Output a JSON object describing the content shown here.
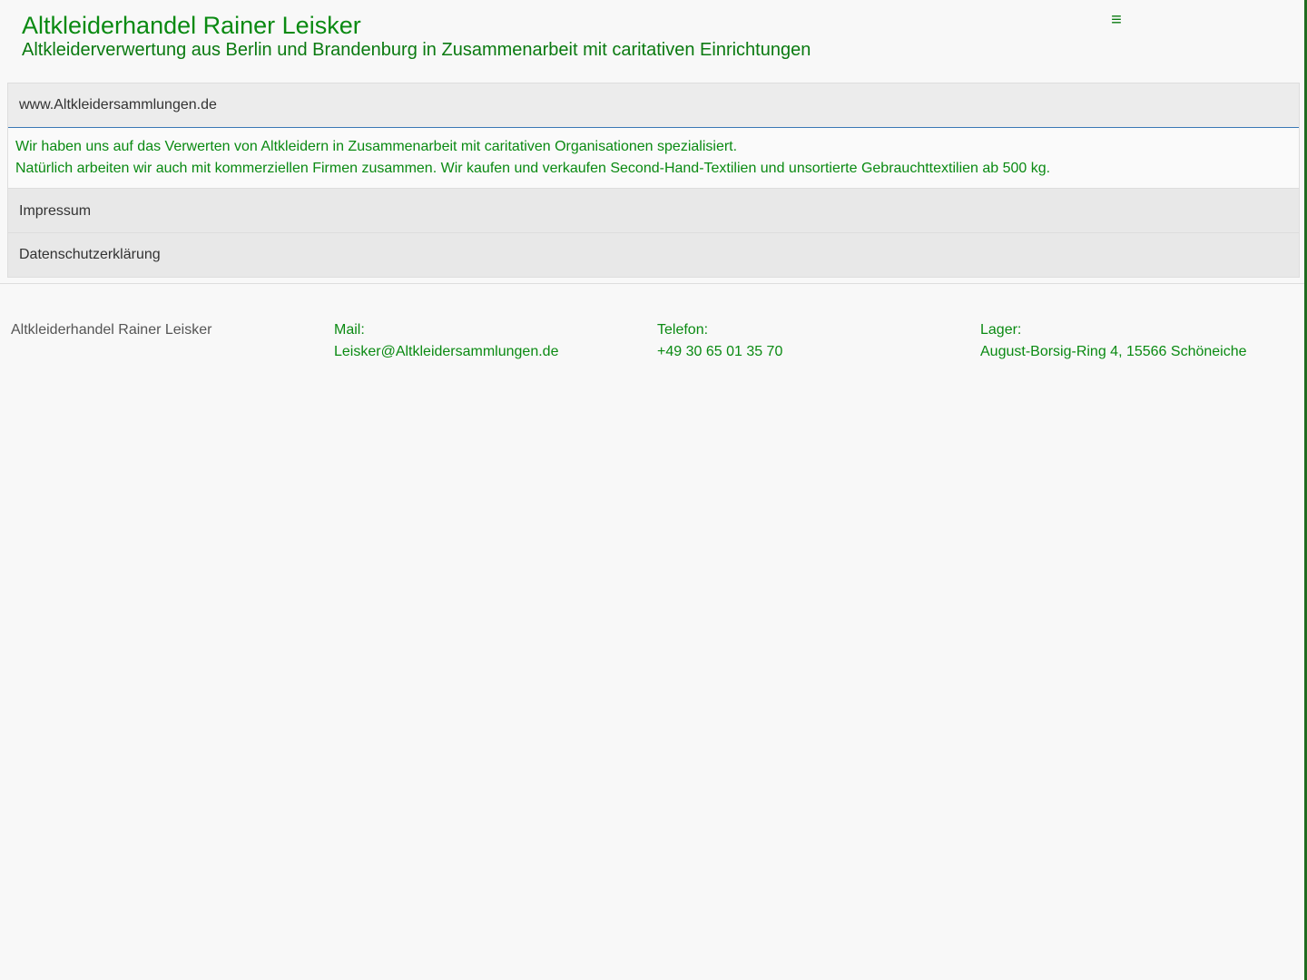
{
  "header": {
    "title": "Altkleiderhandel Rainer Leisker",
    "subtitle": "Altkleiderverwertung aus Berlin und Brandenburg in Zusammenarbeit mit caritativen Einrichtungen",
    "menu_icon": "hamburger-icon",
    "menu_glyph": "≡"
  },
  "accordion": {
    "sections": [
      {
        "label": "www.Altkleidersammlungen.de",
        "expanded": true,
        "content": [
          "Wir haben uns auf das Verwerten von Altkleidern in Zusammenarbeit mit caritativen Organisationen spezialisiert.",
          "Natürlich arbeiten wir auch mit kommerziellen Firmen zusammen. Wir kaufen und verkaufen Second-Hand-Textilien und unsortierte Gebrauchttextilien ab 500 kg."
        ]
      },
      {
        "label": "Impressum",
        "expanded": false
      },
      {
        "label": "Datenschutzerklärung",
        "expanded": false
      }
    ]
  },
  "footer": {
    "company": "Altkleiderhandel Rainer Leisker",
    "mail_label": "Mail:",
    "mail_value": "Leisker@Altkleidersammlungen.de",
    "phone_label": "Telefon:",
    "phone_value": "+49 30 65 01 35 70",
    "storage_label": "Lager:",
    "storage_value": "August-Borsig-Ring 4, 15566 Schöneiche"
  },
  "colors": {
    "accent_green": "#0a8a12",
    "active_border": "#3a78b5",
    "background": "#f8f8f8"
  }
}
